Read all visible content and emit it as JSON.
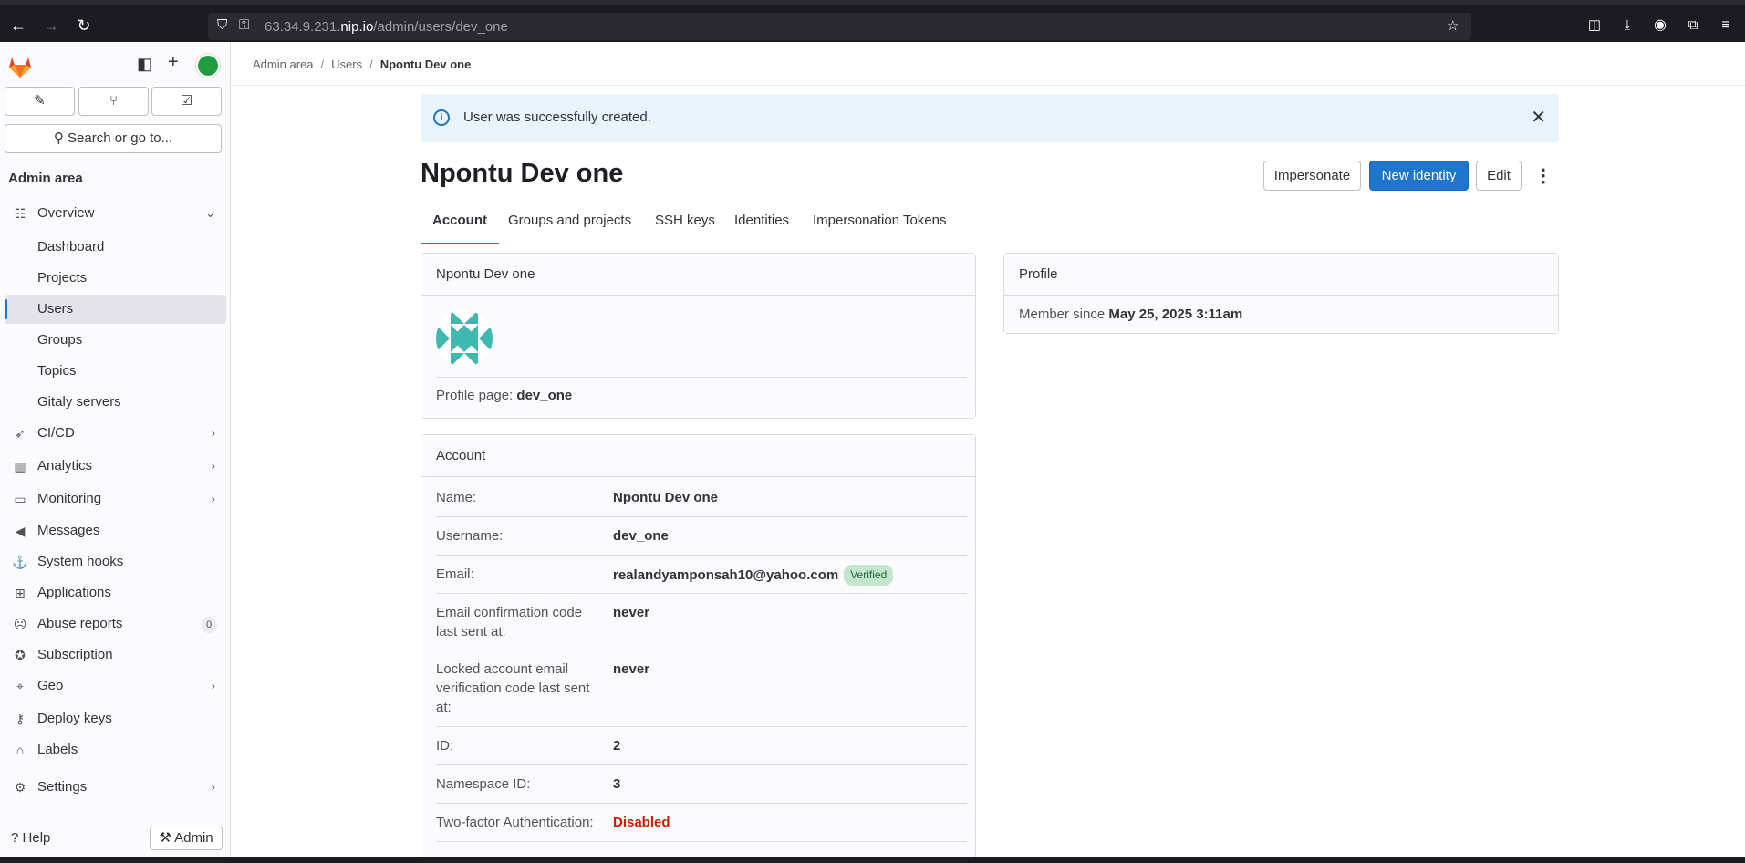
{
  "browser": {
    "url_host": "63.34.9.231.",
    "url_domain": "nip.io",
    "url_path": "/admin/users/dev_one"
  },
  "sidebar": {
    "search_label": "Search or go to...",
    "section_title": "Admin area",
    "items": [
      {
        "label": "Overview",
        "icon": "overview-icon"
      },
      {
        "label": "Dashboard"
      },
      {
        "label": "Projects"
      },
      {
        "label": "Users"
      },
      {
        "label": "Groups"
      },
      {
        "label": "Topics"
      },
      {
        "label": "Gitaly servers"
      },
      {
        "label": "CI/CD",
        "icon": "rocket-icon"
      },
      {
        "label": "Analytics",
        "icon": "chart-icon"
      },
      {
        "label": "Monitoring",
        "icon": "monitor-icon"
      },
      {
        "label": "Messages",
        "icon": "bullhorn-icon"
      },
      {
        "label": "System hooks",
        "icon": "anchor-icon"
      },
      {
        "label": "Applications",
        "icon": "grid-icon"
      },
      {
        "label": "Abuse reports",
        "icon": "abuse-icon",
        "count": "0"
      },
      {
        "label": "Subscription",
        "icon": "license-icon"
      },
      {
        "label": "Geo",
        "icon": "location-icon"
      },
      {
        "label": "Deploy keys",
        "icon": "key-icon"
      },
      {
        "label": "Labels",
        "icon": "label-icon"
      },
      {
        "label": "Settings",
        "icon": "settings-icon"
      }
    ],
    "help_label": "Help",
    "admin_label": "Admin"
  },
  "breadcrumb": [
    "Admin area",
    "Users",
    "Npontu Dev one"
  ],
  "alert": {
    "message": "User was successfully created."
  },
  "page": {
    "title": "Npontu Dev one",
    "buttons": {
      "impersonate": "Impersonate",
      "new_identity": "New identity",
      "edit": "Edit"
    }
  },
  "tabs": [
    "Account",
    "Groups and projects",
    "SSH keys",
    "Identities",
    "Impersonation Tokens"
  ],
  "user_card": {
    "header": "Npontu Dev one",
    "profile_page_label": "Profile page:",
    "profile_page_value": "dev_one"
  },
  "profile_card": {
    "header": "Profile",
    "member_since_label": "Member since",
    "member_since_value": "May 25, 2025 3:11am"
  },
  "account_card": {
    "header": "Account",
    "rows": [
      {
        "key": "Name:",
        "value": "Npontu Dev one"
      },
      {
        "key": "Username:",
        "value": "dev_one"
      },
      {
        "key": "Email:",
        "value": "realandyamponsah10@yahoo.com",
        "badge": "Verified"
      },
      {
        "key": "Email confirmation code last sent at:",
        "value": "never"
      },
      {
        "key": "Locked account email verification code last sent at:",
        "value": "never"
      },
      {
        "key": "ID:",
        "value": "2"
      },
      {
        "key": "Namespace ID:",
        "value": "3"
      },
      {
        "key": "Two-factor Authentication:",
        "value": "Disabled"
      }
    ]
  },
  "colors": {
    "accent": "#1f75cb",
    "danger": "#c91c00",
    "success_bg": "#c3e6cd",
    "avatar": "#1f9c3d"
  }
}
